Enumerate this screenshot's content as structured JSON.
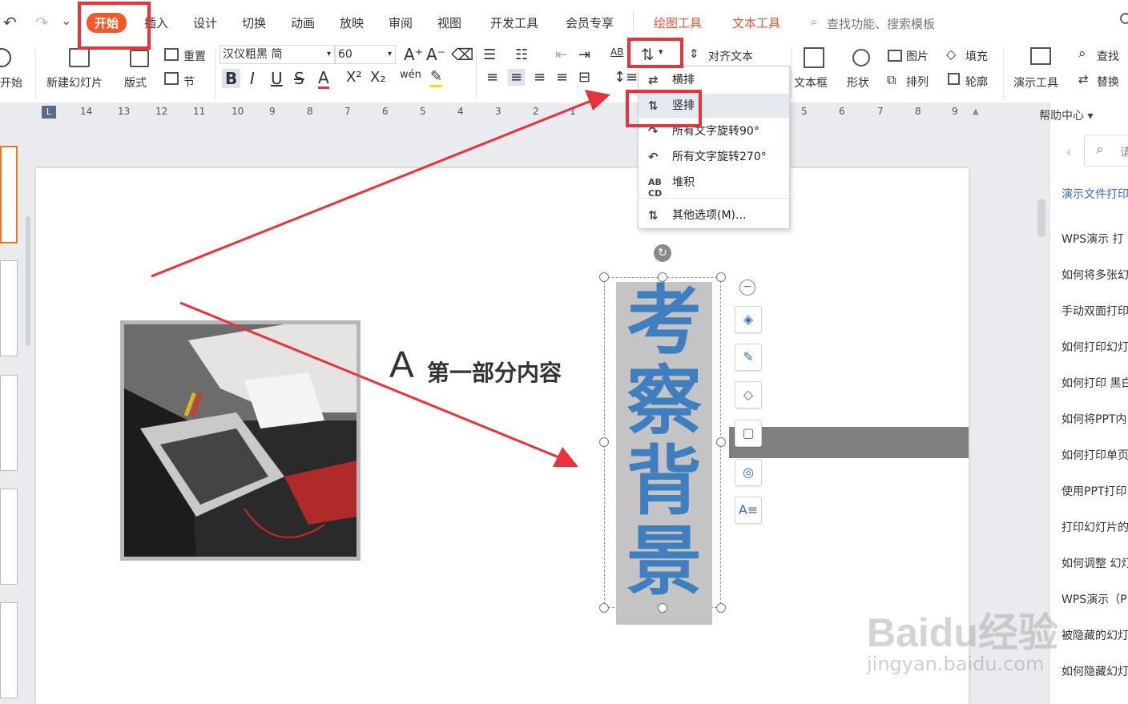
{
  "quick_access": {
    "undo": "↶",
    "redo": "↷",
    "more": "⌄"
  },
  "menu_tabs": [
    "开始",
    "插入",
    "设计",
    "切换",
    "动画",
    "放映",
    "审阅",
    "视图",
    "开发工具",
    "会员专享"
  ],
  "tool_tabs": [
    "绘图工具",
    "文本工具"
  ],
  "menu_search": "查找功能、搜索模板",
  "ribbon": {
    "start_label": "开始",
    "new_slide": "新建幻灯片",
    "layout": "版式",
    "reset": "重置",
    "section": "节",
    "font_name": "汉仪粗黑 简",
    "font_size": "60",
    "bold": "B",
    "italic": "I",
    "underline": "U",
    "strike": "S",
    "font_color": "A",
    "superscript": "X²",
    "subscript": "X₂",
    "pinyin": "wén",
    "align_text": "对齐文本",
    "text_box": "文本框",
    "shape": "形状",
    "picture": "图片",
    "arrange": "排列",
    "fill": "填充",
    "outline": "轮廓",
    "presentation_tools": "演示工具",
    "find": "查找",
    "replace": "替换"
  },
  "ruler_numbers": [
    "14",
    "13",
    "12",
    "11",
    "10",
    "9",
    "8",
    "7",
    "6",
    "5",
    "4",
    "3",
    "2",
    "1",
    "5",
    "6",
    "7",
    "8",
    "9"
  ],
  "text_direction_menu": {
    "items": [
      "横排",
      "竖排",
      "所有文字旋转90°",
      "所有文字旋转270°",
      "堆积"
    ],
    "more": "其他选项(M)..."
  },
  "slide": {
    "section_letter": "A",
    "section_title": "第一部分内容",
    "vertical_text": [
      "考",
      "察",
      "背",
      "景"
    ],
    "image_alt": "laptop-photo"
  },
  "help_panel": {
    "title": "帮助中心",
    "search_placeholder": "请",
    "items": [
      "演示文件打印",
      "WPS演示 打",
      "如何将多张幻",
      "手动双面打印",
      "如何打印幻灯",
      "如何打印 黑白",
      "如何将PPT内",
      "如何打印单页",
      "使用PPT打印",
      "打印幻灯片的",
      "如何调整 幻灯",
      "WPS演示（P",
      "被隐藏的幻灯",
      "如何隐藏幻灯"
    ]
  },
  "watermark": {
    "brand": "Baidu经验",
    "url": "jingyan.baidu.com"
  },
  "colors": {
    "accent": "#f05a28",
    "highlight": "#e8323c",
    "text_blue": "#3f7fc0",
    "textbox_gray": "#c4c4c4"
  }
}
